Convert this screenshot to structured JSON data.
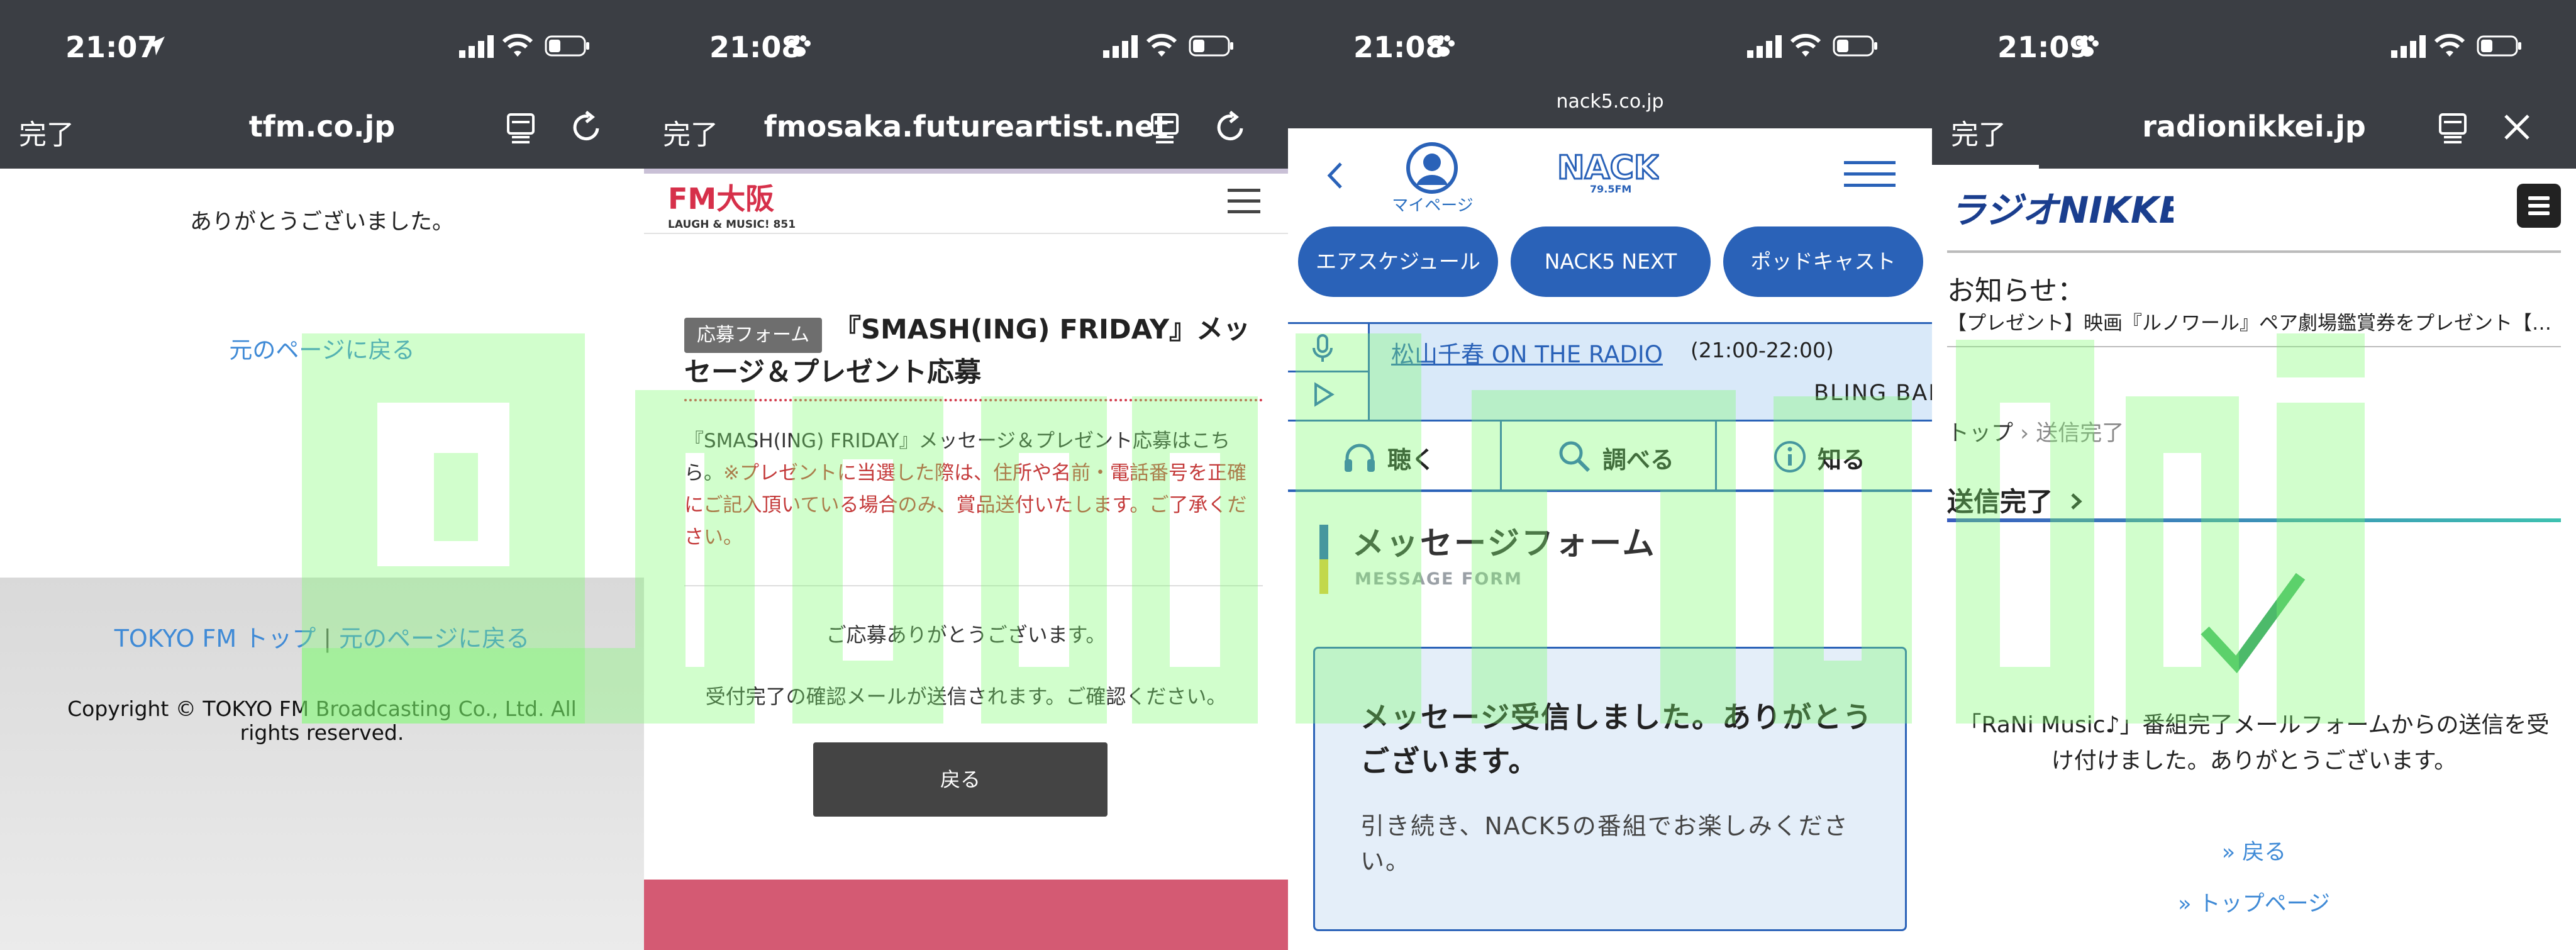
{
  "panel1": {
    "status_time": "21:07",
    "browser": {
      "done": "完了",
      "url": "tfm.co.jp"
    },
    "thanks": "ありがとうございました。",
    "back_link": "元のページに戻る",
    "footer": {
      "link1": "TOKYO FM トップ",
      "separator": "|",
      "link2": "元のページに戻る",
      "copyright": "Copyright © TOKYO FM Broadcasting Co., Ltd. All rights reserved."
    }
  },
  "panel2": {
    "status_time": "21:08",
    "browser": {
      "done": "完了",
      "url": "fmosaka.futureartist.net"
    },
    "logo_text": "FM大阪",
    "logo_sub": "LAUGH & MUSIC! 851",
    "tag": "応募フォーム",
    "title": "『SMASH(ING) FRIDAY』メッセージ＆プレゼント応募",
    "desc_plain": "『SMASH(ING) FRIDAY』メッセージ＆プレゼント応募はこちら。",
    "desc_red": "※プレゼントに当選した際は、住所や名前・電話番号を正確にご記入頂いている場合のみ、賞品送付いたします。ご了承ください。",
    "thanks": "ご応募ありがとうございます。",
    "mail_note": "受付完了の確認メールが送信されます。ご確認ください。",
    "back_button": "戻る"
  },
  "panel3": {
    "status_time": "21:08",
    "domain": "nack5.co.jp",
    "mypage": "マイページ",
    "logo_text": "NACK5",
    "logo_sub": "79.5FM",
    "pills": [
      "エアスケジュール",
      "NACK5 NEXT",
      "ポッドキャスト"
    ],
    "program": "松山千春 ON THE RADIO",
    "program_time": "(21:00-22:00)",
    "song": "BLING BANG BANG BORN",
    "tabs": [
      "聴く",
      "調べる",
      "知る"
    ],
    "form_title": "メッセージフォーム",
    "form_sub": "MESSAGE FORM",
    "box_title": "メッセージ受信しました。ありがとうございます。",
    "box_text": "引き続き、NACK5の番組でお楽しみください。"
  },
  "panel4": {
    "status_time": "21:09",
    "browser": {
      "done": "完了",
      "url": "radionikkei.jp"
    },
    "logo_text": "ラジオNIKKEI",
    "news_label": "お知らせ：",
    "news": "【プレゼント】映画『ルノワール』ペア劇場鑑賞券をプレゼント【…",
    "breadcrumb": {
      "top": "トップ",
      "sep": "›",
      "current": "送信完了"
    },
    "done_heading": "送信完了",
    "message": "「RaNi Music♪」番組完了メールフォームからの送信を受け付けました。ありがとうございます。",
    "back_link": "» 戻る",
    "top_link": "» トップページ"
  },
  "colors": {
    "bar_bg": "#3b3e44",
    "link_blue": "#3f8ad6",
    "nack5_blue": "#2a62b8",
    "fmosaka_pink": "#d45a73",
    "check_green": "#4cba6a",
    "watermark_green": "#7CFC6E"
  }
}
